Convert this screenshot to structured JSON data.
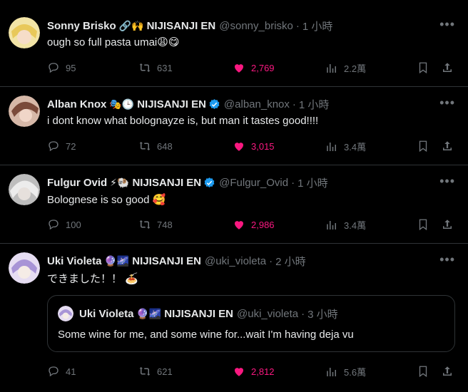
{
  "tweets": [
    {
      "name": "Sonny Brisko",
      "emojis": "🔗🙌",
      "group": "NIJISANJI EN",
      "verified": false,
      "handle": "@sonny_brisko",
      "time": "1 小時",
      "text": "ough so full pasta umai😩😋",
      "replies": "95",
      "retweets": "631",
      "likes": "2,769",
      "views": "2.2萬",
      "avatar_colors": [
        "#f2e4a6",
        "#3a3a4a"
      ]
    },
    {
      "name": "Alban Knox",
      "emojis": "🎭🕒",
      "group": "NIJISANJI EN",
      "verified": true,
      "handle": "@alban_knox",
      "time": "1 小時",
      "text": "i dont know what bolognayze is, but man it tastes good!!!!",
      "replies": "72",
      "retweets": "648",
      "likes": "3,015",
      "views": "3.4萬",
      "avatar_colors": [
        "#8a5a48",
        "#d6b8a8"
      ]
    },
    {
      "name": "Fulgur Ovid",
      "emojis": "⚡🐏",
      "group": "NIJISANJI EN",
      "verified": true,
      "handle": "@Fulgur_Ovid",
      "time": "1 小時",
      "text": "Bolognese is so good 🥰",
      "replies": "100",
      "retweets": "748",
      "likes": "2,986",
      "views": "3.4萬",
      "avatar_colors": [
        "#d8d8d8",
        "#555555"
      ]
    },
    {
      "name": "Uki Violeta",
      "emojis": "🔮🌌",
      "group": "NIJISANJI EN",
      "verified": false,
      "handle": "@uki_violeta",
      "time": "2 小時",
      "text": "できました！！ 🍝",
      "replies": "41",
      "retweets": "621",
      "likes": "2,812",
      "views": "5.6萬",
      "avatar_colors": [
        "#c9b6e8",
        "#4a3a66"
      ],
      "quote": {
        "name": "Uki Violeta",
        "emojis": "🔮🌌",
        "group": "NIJISANJI EN",
        "handle": "@uki_violeta",
        "time": "3 小時",
        "text": "Some wine for me, and some wine for...wait I'm having deja vu"
      }
    }
  ],
  "colors": {
    "background": "#000000",
    "text": "#e7e9ea",
    "muted": "#71767b",
    "like": "#f91880",
    "verified": "#1d9bf0",
    "border": "#2f3336"
  }
}
